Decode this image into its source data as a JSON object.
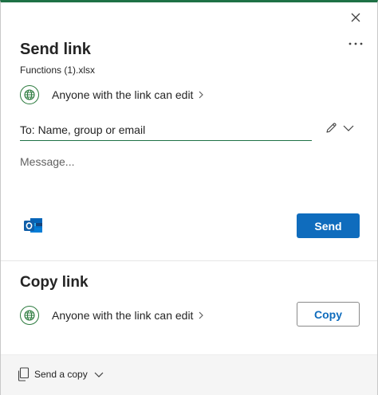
{
  "dialog": {
    "title": "Send link",
    "file_name": "Functions (1).xlsx",
    "accent_color": "#1e7145",
    "close_icon": "close-icon",
    "more_icon": "more-options-icon"
  },
  "send_section": {
    "permission_text": "Anyone with the link can edit",
    "to_placeholder": "To: Name, group or email",
    "to_value": "",
    "message_placeholder": "Message...",
    "message_value": "",
    "send_label": "Send",
    "send_color": "#0f6cbd"
  },
  "copy_section": {
    "title": "Copy link",
    "permission_text": "Anyone with the link can edit",
    "copy_label": "Copy"
  },
  "footer": {
    "send_copy_label": "Send a copy"
  }
}
